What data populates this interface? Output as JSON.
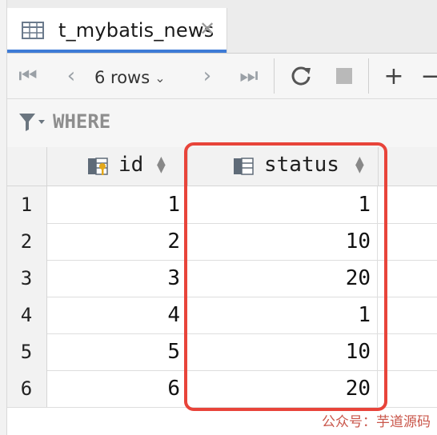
{
  "tab": {
    "title": "t_mybatis_news",
    "icon": "table-icon",
    "close_icon": "close-icon"
  },
  "toolbar": {
    "rows_label": "6 rows",
    "first_icon": "first-page-icon",
    "prev_icon": "previous-page-icon",
    "next_icon": "next-page-icon",
    "last_icon": "last-page-icon",
    "refresh_icon": "refresh-icon",
    "stop_icon": "stop-icon",
    "add_icon": "add-row-icon"
  },
  "filter": {
    "label": "WHERE",
    "icon": "filter-icon"
  },
  "table": {
    "columns": [
      {
        "label": "id",
        "icon": "primary-key-column-icon"
      },
      {
        "label": "status",
        "icon": "column-icon"
      }
    ],
    "rows": [
      {
        "num": "1",
        "id": "1",
        "status": "1"
      },
      {
        "num": "2",
        "id": "2",
        "status": "10"
      },
      {
        "num": "3",
        "id": "3",
        "status": "20"
      },
      {
        "num": "4",
        "id": "4",
        "status": "1"
      },
      {
        "num": "5",
        "id": "5",
        "status": "10"
      },
      {
        "num": "6",
        "id": "6",
        "status": "20"
      }
    ]
  },
  "annotation": {
    "color": "#e8443a"
  },
  "watermark": {
    "text": "公众号：芋道源码"
  },
  "colors": {
    "accent": "#3d7bd6",
    "highlight": "#e8443a"
  }
}
